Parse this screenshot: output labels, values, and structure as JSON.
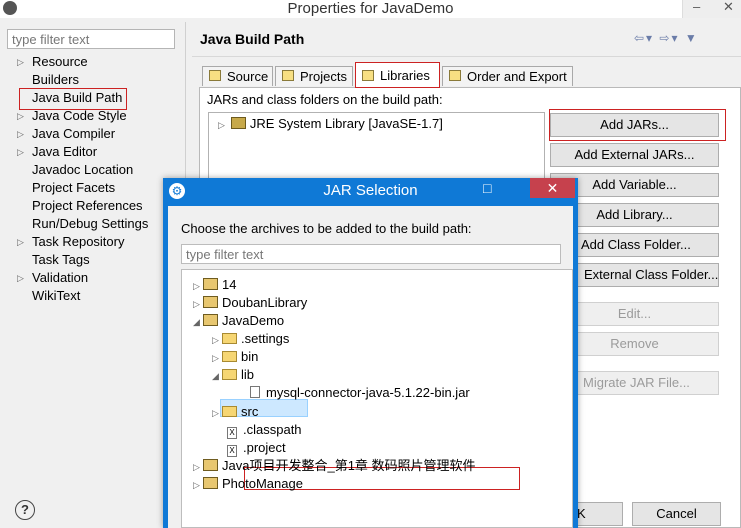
{
  "window": {
    "title": "Properties for JavaDemo"
  },
  "left_panel": {
    "filter_placeholder": "type filter text",
    "items": [
      {
        "label": "Resource",
        "expandable": true
      },
      {
        "label": "Builders",
        "expandable": false
      },
      {
        "label": "Java Build Path",
        "expandable": false
      },
      {
        "label": "Java Code Style",
        "expandable": true
      },
      {
        "label": "Java Compiler",
        "expandable": true
      },
      {
        "label": "Java Editor",
        "expandable": true
      },
      {
        "label": "Javadoc Location",
        "expandable": false
      },
      {
        "label": "Project Facets",
        "expandable": false
      },
      {
        "label": "Project References",
        "expandable": false
      },
      {
        "label": "Run/Debug Settings",
        "expandable": false
      },
      {
        "label": "Task Repository",
        "expandable": true
      },
      {
        "label": "Task Tags",
        "expandable": false
      },
      {
        "label": "Validation",
        "expandable": true
      },
      {
        "label": "WikiText",
        "expandable": false
      }
    ],
    "selected": "Java Build Path"
  },
  "page": {
    "title": "Java Build Path",
    "tabs": [
      "Source",
      "Projects",
      "Libraries",
      "Order and Export"
    ],
    "active_tab": "Libraries",
    "libraries_label": "JARs and class folders on the build path:",
    "library_entries": [
      "JRE System Library [JavaSE-1.7]"
    ],
    "buttons": {
      "add_jars": "Add JARs...",
      "add_external_jars": "Add External JARs...",
      "add_variable": "Add Variable...",
      "add_library": "Add Library...",
      "add_class_folder": "Add Class Folder...",
      "add_external_class_folder": "External Class Folder...",
      "edit": "Edit...",
      "remove": "Remove",
      "migrate_jar": "Migrate JAR File..."
    }
  },
  "bottom": {
    "help": "?",
    "ok_label": "K",
    "cancel_label": "Cancel"
  },
  "dialog": {
    "title": "JAR Selection",
    "instruction": "Choose the archives to be added to the build path:",
    "filter_placeholder": "type filter text",
    "tree": {
      "n14": "14",
      "douban": "DoubanLibrary",
      "javademo": "JavaDemo",
      "settings": ".settings",
      "bin": "bin",
      "lib": "lib",
      "jar": "mysql-connector-java-5.1.22-bin.jar",
      "src": "src",
      "classpath": ".classpath",
      "project": ".project",
      "chapter1": "Java项目开发整合_第1章  数码照片管理软件",
      "photomanage": "PhotoManage"
    },
    "selected_node": "JavaDemo"
  },
  "colors": {
    "highlight_box": "#cc2222",
    "dialog_titlebar": "#0f79d6",
    "close_button": "#c6414d",
    "selection": "#cde8ff"
  },
  "icons": {
    "back": "back-arrow-icon",
    "forward": "forward-arrow-icon",
    "menu": "view-menu-icon"
  }
}
